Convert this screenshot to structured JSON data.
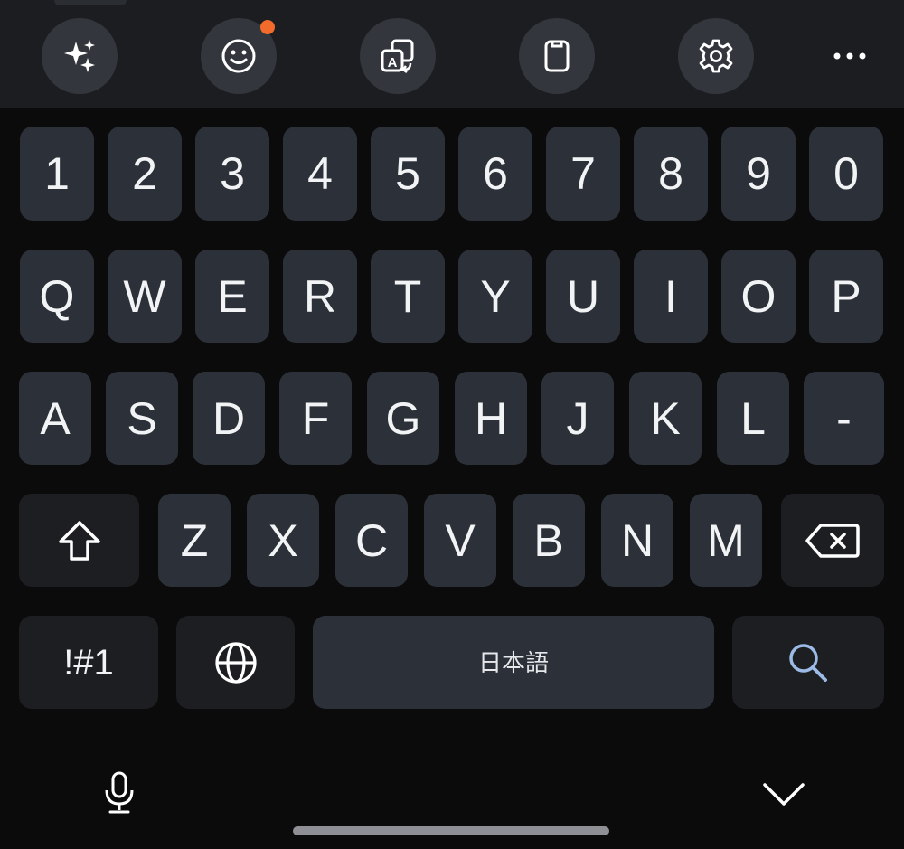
{
  "toolbar": {
    "buttons": [
      {
        "name": "ai-sparkle-icon",
        "has_badge": false
      },
      {
        "name": "emoji-icon",
        "has_badge": true
      },
      {
        "name": "translate-icon",
        "has_badge": false
      },
      {
        "name": "clipboard-icon",
        "has_badge": false
      },
      {
        "name": "settings-gear-icon",
        "has_badge": false
      }
    ],
    "more_icon": "more-dots-icon",
    "badge_color": "#f26b2a"
  },
  "keyboard": {
    "number_row": [
      "1",
      "2",
      "3",
      "4",
      "5",
      "6",
      "7",
      "8",
      "9",
      "0"
    ],
    "top_row": [
      "Q",
      "W",
      "E",
      "R",
      "T",
      "Y",
      "U",
      "I",
      "O",
      "P"
    ],
    "middle_row": [
      "A",
      "S",
      "D",
      "F",
      "G",
      "H",
      "J",
      "K",
      "L",
      "-"
    ],
    "bottom_row": [
      "Z",
      "X",
      "C",
      "V",
      "B",
      "N",
      "M"
    ],
    "shift_icon": "shift-arrow-icon",
    "backspace_icon": "backspace-icon",
    "symbols_label": "!#1",
    "globe_icon": "globe-icon",
    "space_label": "日本語",
    "search_icon": "search-icon"
  },
  "footer": {
    "mic_icon": "microphone-icon",
    "hide_icon": "chevron-down-icon"
  },
  "colors": {
    "background": "#0b0b0c",
    "toolbar": "#1b1d21",
    "key": "#2c3038",
    "key_dark": "#1c1e22",
    "search_accent": "#9bbbe6"
  }
}
